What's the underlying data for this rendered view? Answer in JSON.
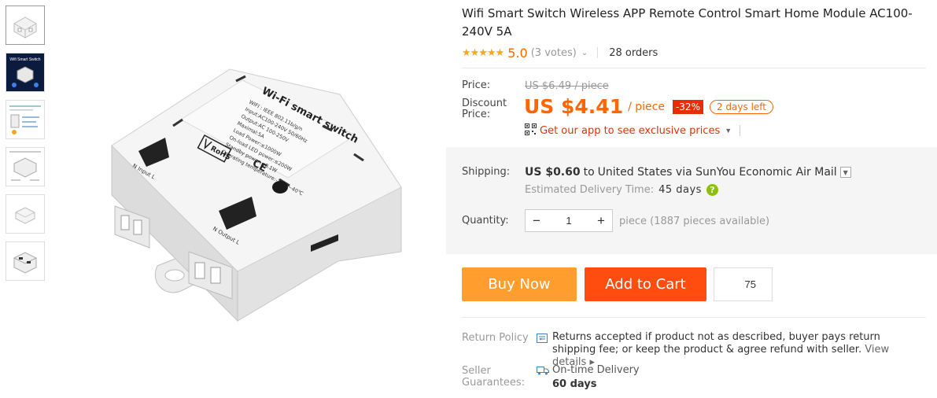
{
  "product": {
    "title": "Wifi Smart Switch Wireless APP Remote Control Smart Home Module AC100-240V 5A",
    "stars": "★★★★★",
    "rating": "5.0",
    "votes": "(3 votes)",
    "orders": "28 orders"
  },
  "pricing": {
    "price_label": "Price:",
    "original_price": "US $6.49 / piece",
    "discount_label": "Discount Price:",
    "discount_price": "US $4.41",
    "unit": "/ piece",
    "discount_badge": "-32%",
    "days_left": "2 days left",
    "app_promo": "Get our app to see exclusive prices"
  },
  "shipping": {
    "label": "Shipping:",
    "cost": "US $0.60",
    "to": "to",
    "destination": "United States via SunYou Economic Air Mail",
    "eta_label": "Estimated Delivery Time:",
    "eta_value": "45 days",
    "help": "?"
  },
  "quantity": {
    "label": "Quantity:",
    "minus": "−",
    "value": "1",
    "plus": "+",
    "available": "piece (1887 pieces available)"
  },
  "actions": {
    "buy_now": "Buy Now",
    "add_to_cart": "Add to Cart",
    "wishlist_count": "75"
  },
  "return_policy": {
    "label": "Return Policy",
    "text": "Returns accepted if product not as described, buyer pays return shipping fee; or keep the product & agree refund with seller.",
    "link": "View details ▸"
  },
  "guarantee": {
    "label": "Seller Guarantees:",
    "text": "On-time Delivery",
    "days": "60 days"
  },
  "image_text": {
    "brand": "Wi-Fi smart switch",
    "spec_lines": [
      "WIFI : IEEE 802.11b/g/n",
      "Input:AC100-240V 50/60Hz",
      "Output:AC 100-250V",
      "Maximal:5A",
      "Load Power:≤1000W",
      "On-load LED power:≤200W",
      "Standby power:≤0.1W",
      "Operating temperature:-20℃~40℃"
    ],
    "rohs": "RoHS",
    "ce": "CE",
    "input_label": "N  Input  L",
    "output_label": "N Output L",
    "thumb_title": "Wifi Smart Switch"
  },
  "colors": {
    "accent": "#ff6600",
    "buy": "#ff9d2f",
    "cart": "#ff4d0f",
    "badge": "#e62e04"
  },
  "icons": [
    "star-icon",
    "chevron-down-icon",
    "qr-code-icon",
    "help-icon",
    "return-policy-icon",
    "delivery-truck-icon"
  ]
}
